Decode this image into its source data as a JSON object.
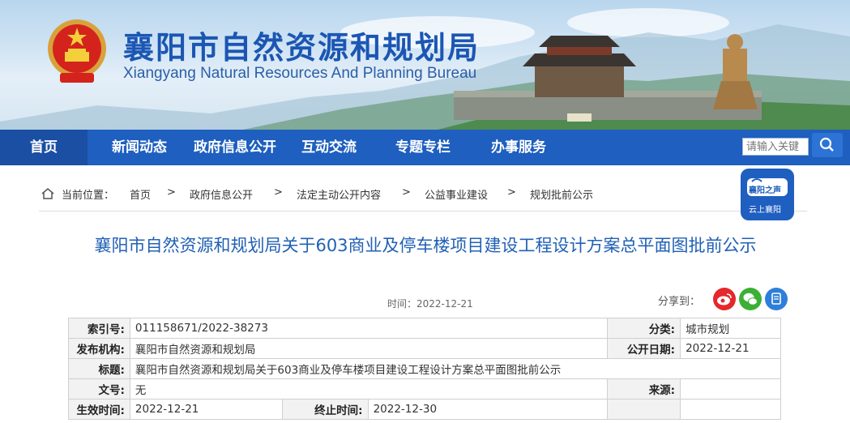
{
  "header": {
    "title": "襄阳市自然资源和规划局",
    "subtitle": "Xiangyang Natural Resources And Planning Bureau"
  },
  "nav": {
    "items": [
      "首页",
      "新闻动态",
      "政府信息公开",
      "互动交流",
      "专题专栏",
      "办事服务"
    ]
  },
  "search": {
    "placeholder": "请输入关键"
  },
  "breadcrumb": {
    "label": "当前位置：",
    "items": [
      "首页",
      "政府信息公开",
      "法定主动公开内容",
      "公益事业建设",
      "规划批前公示"
    ],
    "separator": ">"
  },
  "app_badge": {
    "line1": "襄阳之声",
    "line2": "云上襄阳"
  },
  "article": {
    "title": "襄阳市自然资源和规划局关于603商业及停车楼项目建设工程设计方案总平面图批前公示",
    "time_label": "时间：",
    "time": "2022-12-21",
    "share_label": "分享到："
  },
  "info": {
    "index_label": "索引号:",
    "index": "011158671/2022-38273",
    "category_label": "分类:",
    "category": "城市规划",
    "publisher_label": "发布机构:",
    "publisher": "襄阳市自然资源和规划局",
    "date_label": "公开日期:",
    "date": "2022-12-21",
    "title_label": "标题:",
    "title": "襄阳市自然资源和规划局关于603商业及停车楼项目建设工程设计方案总平面图批前公示",
    "doc_label": "文号:",
    "doc": "无",
    "source_label": "来源:",
    "source": "",
    "effective_label": "生效时间:",
    "effective": "2022-12-21",
    "end_label": "终止时间:",
    "end": "2022-12-30"
  },
  "colors": {
    "primary": "#1e5fbf",
    "title_blue": "#2160b5",
    "weibo": "#e6272b",
    "wechat": "#3cb034",
    "other": "#2e7fd9"
  },
  "icons": [
    "emblem-icon",
    "search-icon",
    "home-icon",
    "weibo-icon",
    "wechat-icon",
    "copy-icon"
  ]
}
